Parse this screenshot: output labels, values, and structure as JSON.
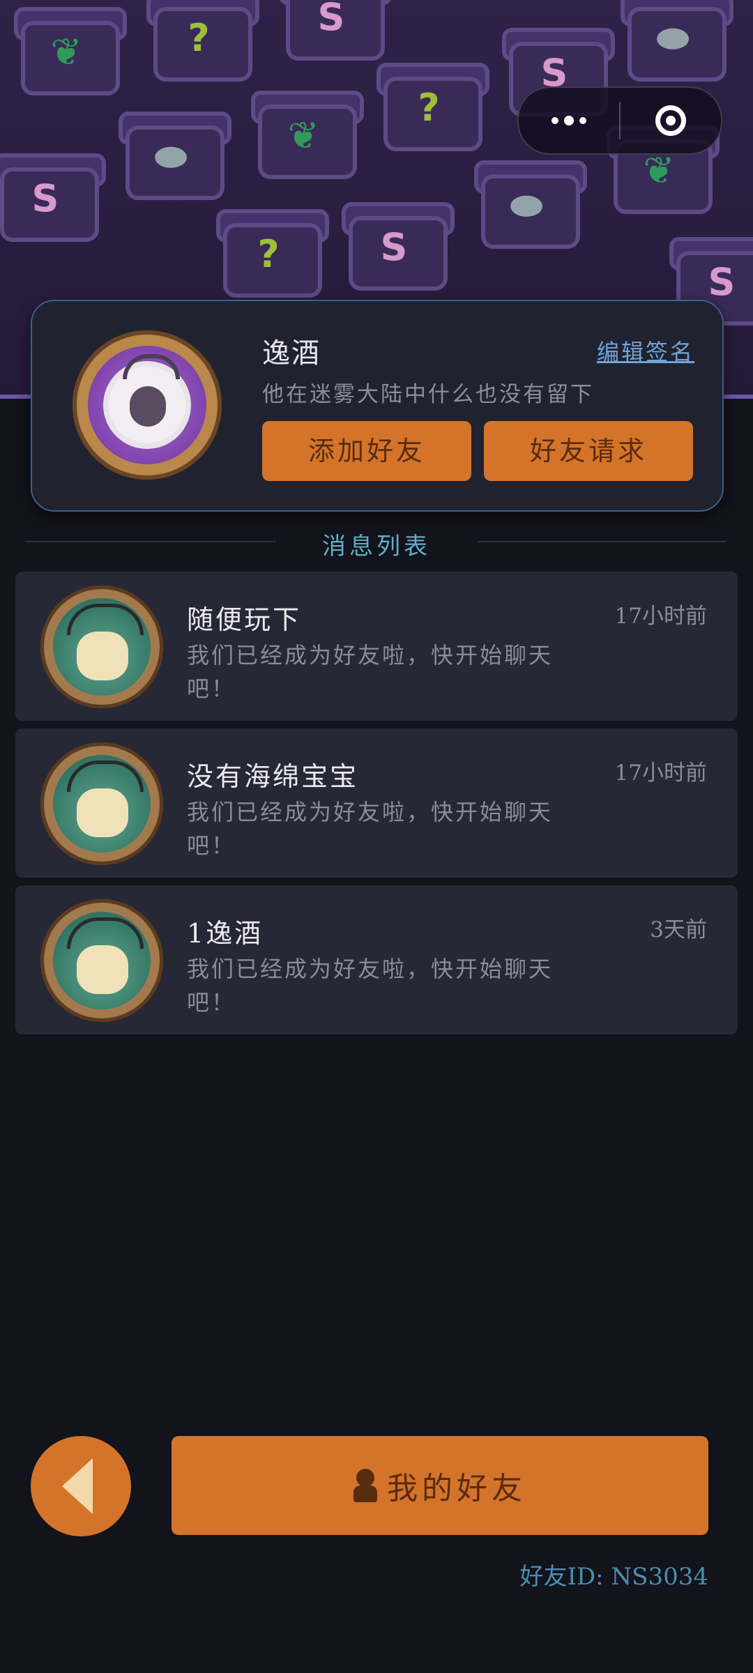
{
  "top_bar": {
    "more_icon": "more-dots-icon",
    "close_icon": "target-icon"
  },
  "profile": {
    "name": "逸酒",
    "edit_signature_label": "编辑签名",
    "bio": "他在迷雾大陆中什么也没有留下",
    "add_friend_label": "添加好友",
    "friend_request_label": "好友请求",
    "avatar_icon": "sheep-avatar"
  },
  "section": {
    "title": "消息列表"
  },
  "messages": [
    {
      "name": "随便玩下",
      "text": "我们已经成为好友啦，快开始聊天吧！",
      "time": "17小时前",
      "avatar": "antler-creature-avatar"
    },
    {
      "name": "没有海绵宝宝",
      "text": "我们已经成为好友啦，快开始聊天吧！",
      "time": "17小时前",
      "avatar": "antler-creature-avatar"
    },
    {
      "name": "1逸酒",
      "text": "我们已经成为好友啦，快开始聊天吧！",
      "time": "3天前",
      "avatar": "antler-creature-avatar"
    }
  ],
  "bottom": {
    "back_icon": "back-arrow-icon",
    "my_friends_label": "我的好友",
    "friend_id": "好友ID: NS3034"
  },
  "colors": {
    "accent_orange": "#d4742a",
    "background": "#12131b",
    "card": "#262835",
    "section_title": "#5fb0c4",
    "link": "#6ea4d8"
  }
}
